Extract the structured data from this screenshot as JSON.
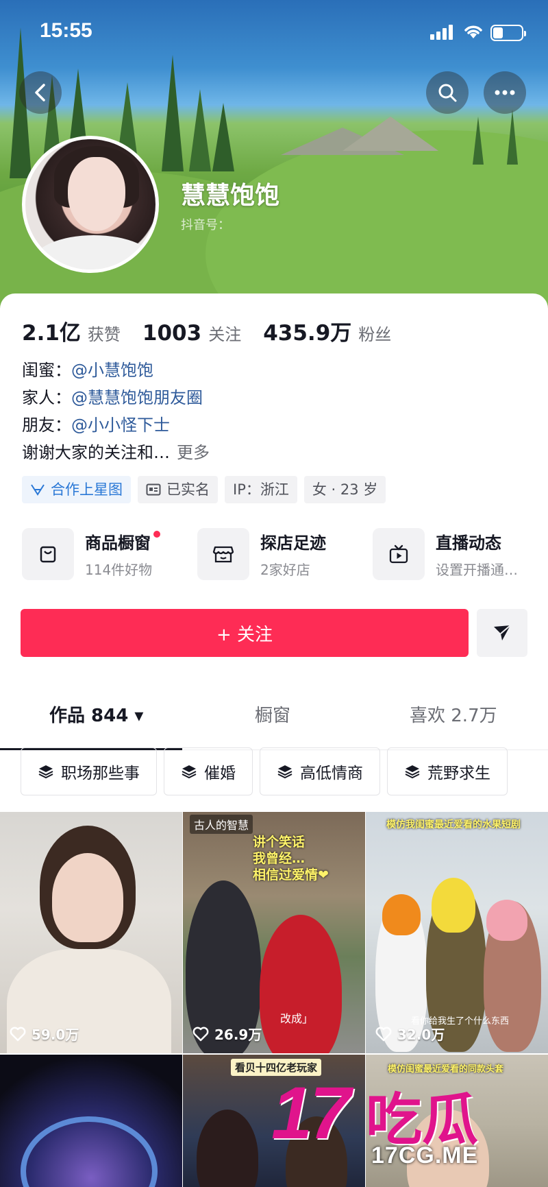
{
  "status_bar": {
    "time": "15:55"
  },
  "profile": {
    "name": "慧慧饱饱",
    "douyin_id_label": "抖音号："
  },
  "stats": [
    {
      "value": "2.1亿",
      "label": "获赞"
    },
    {
      "value": "1003",
      "label": "关注"
    },
    {
      "value": "435.9万",
      "label": "粉丝"
    }
  ],
  "bio": {
    "lines": [
      {
        "prefix": "闺蜜：",
        "mention": "@小慧饱饱"
      },
      {
        "prefix": "家人：",
        "mention": "@慧慧饱饱朋友圈"
      },
      {
        "prefix": "朋友：",
        "mention": "@小小怪下士"
      }
    ],
    "text": "谢谢大家的关注和…",
    "more": "更多"
  },
  "tags": [
    {
      "label": "合作上星图",
      "icon": "star-map-icon"
    },
    {
      "label": "已实名",
      "icon": "id-card-icon"
    },
    {
      "label": "IP：浙江"
    },
    {
      "label": "女 · 23 岁"
    }
  ],
  "shortcuts": [
    {
      "title": "商品橱窗",
      "sub": "114件好物",
      "icon": "shopping-bag-icon",
      "has_dot": true
    },
    {
      "title": "探店足迹",
      "sub": "2家好店",
      "icon": "store-icon"
    },
    {
      "title": "直播动态",
      "sub": "设置开播通…",
      "icon": "tv-icon"
    }
  ],
  "actions": {
    "follow": "+ 关注"
  },
  "tabs": [
    {
      "label": "作品 844 ▾",
      "active": true
    },
    {
      "label": "橱窗"
    },
    {
      "label": "喜欢 2.7万"
    }
  ],
  "chips": [
    "职场那些事",
    "催婚",
    "高低情商",
    "荒野求生"
  ],
  "videos": [
    {
      "likes": "59.0万"
    },
    {
      "likes": "26.9万",
      "caption_top": "古人的智慧",
      "caption_overlay": "讲个笑话\n我曾经…\n相信过爱情❤",
      "caption_bottom": "改成」"
    },
    {
      "likes": "32.0万",
      "caption_top": "模仿我闺蜜最近爱看的水果短剧",
      "caption_bottom": "看你给我生了个什么东西"
    },
    {
      "likes": ""
    },
    {
      "likes": "",
      "caption_top": "看贝十四亿老玩家"
    },
    {
      "likes": "",
      "caption_top": "模仿闺蜜最近爱看的同款头套"
    }
  ],
  "watermark": {
    "number": "17",
    "chinese": "吃瓜",
    "domain": "17CG.ME"
  },
  "colors": {
    "accent": "#fe2c55",
    "mention": "#2e5a9a",
    "watermark": "#e0148c"
  }
}
